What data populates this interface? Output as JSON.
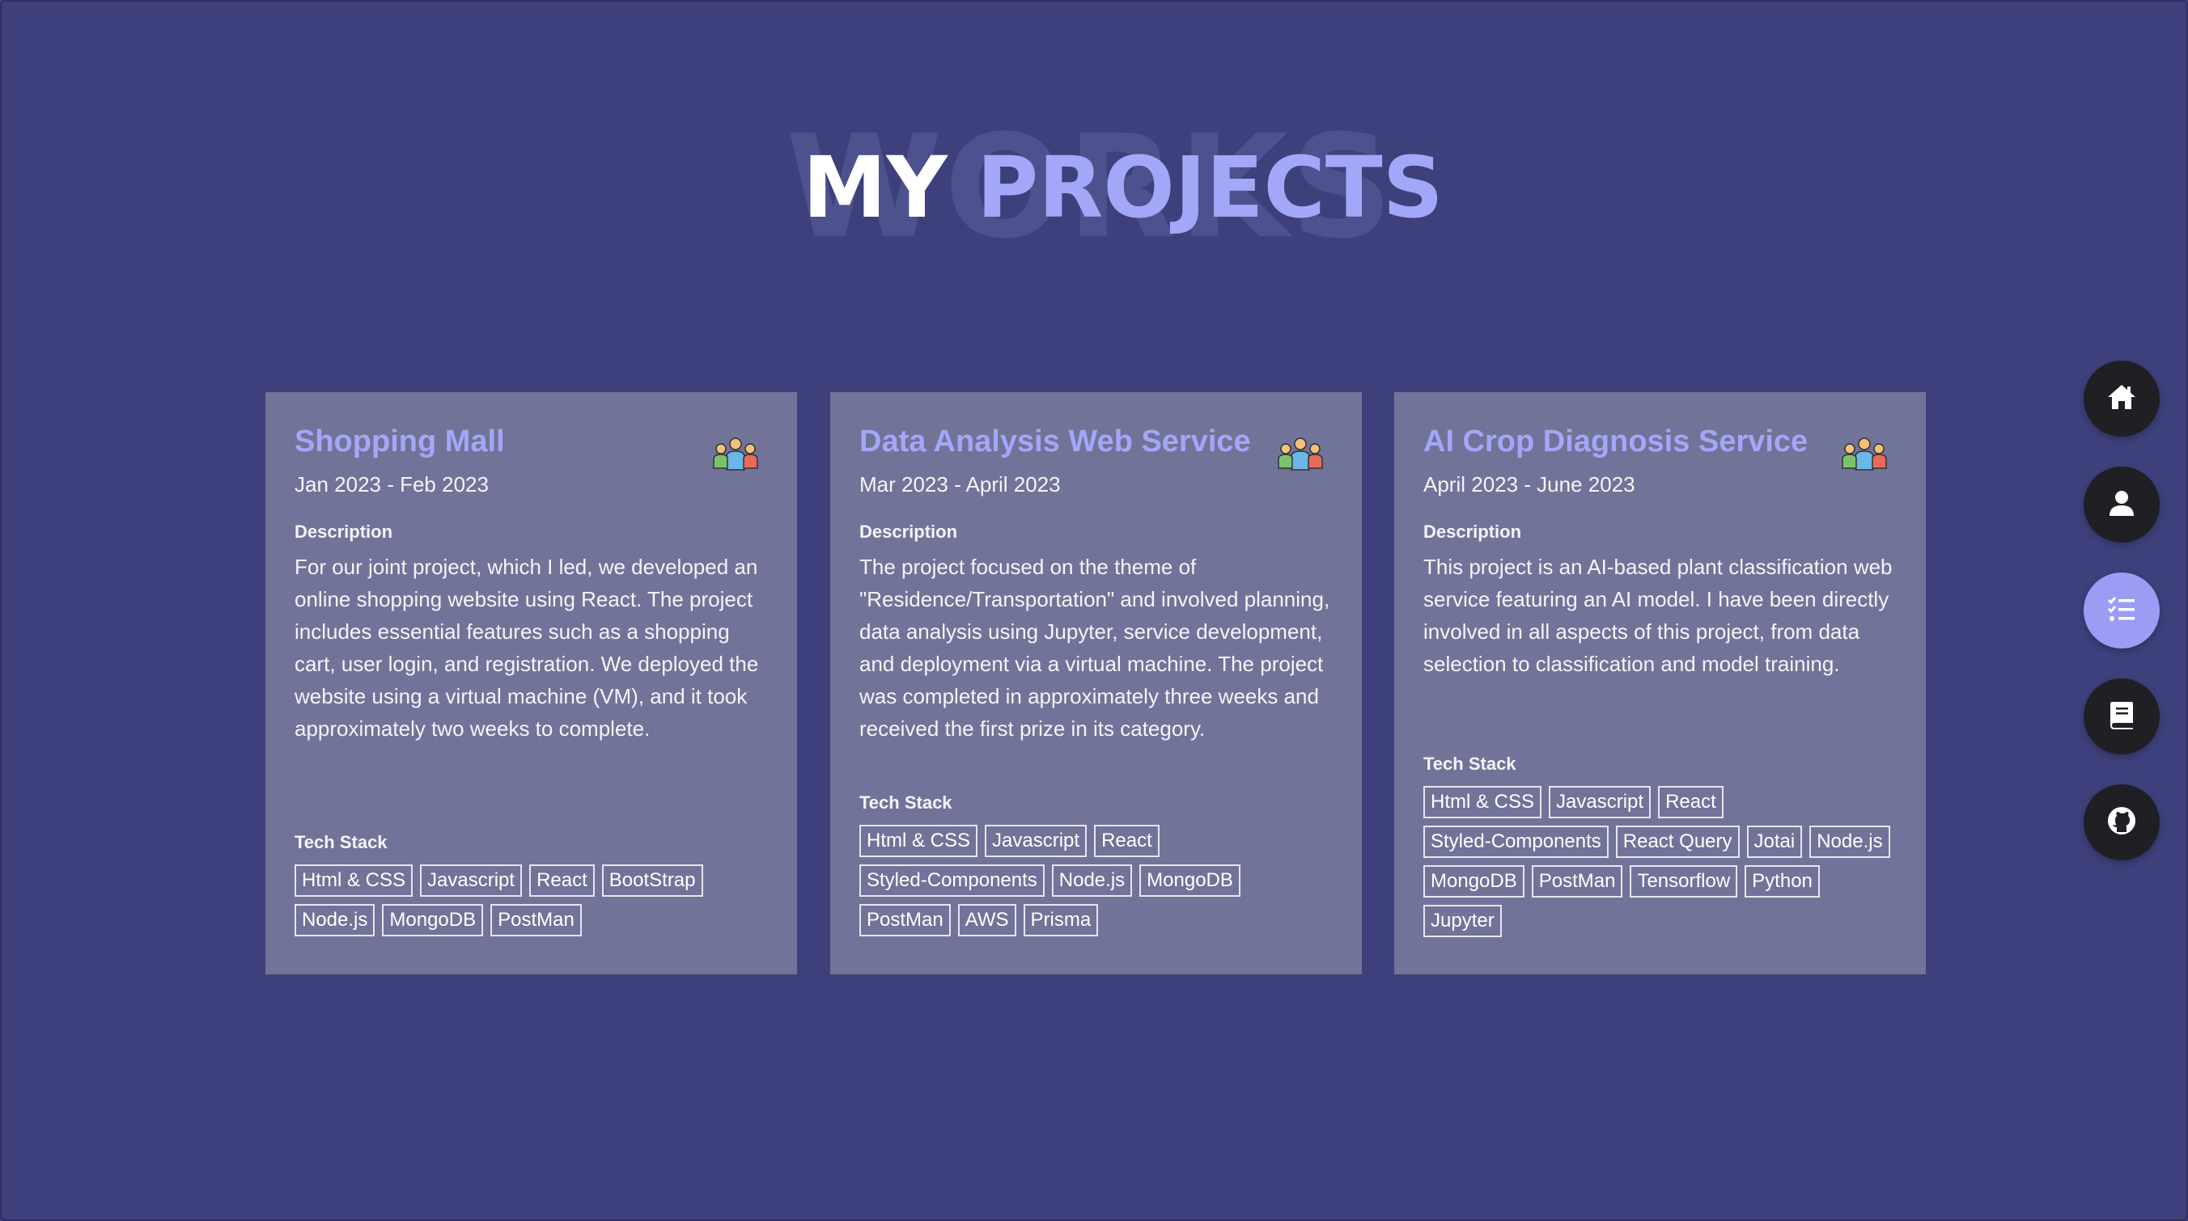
{
  "header": {
    "background_word": "WORKS",
    "title_part1": "MY",
    "title_part2": "PROJECTS"
  },
  "cards": [
    {
      "title": "Shopping Mall",
      "date": "Jan 2023 - Feb 2023",
      "icon": "team-icon",
      "description_label": "Description",
      "description": "For our joint project, which I led, we developed an online shopping website using React. The project includes essential features such as a shopping cart, user login, and registration. We deployed the website using a virtual machine (VM), and it took approximately two weeks to complete.",
      "tech_label": "Tech Stack",
      "tech": [
        "Html & CSS",
        "Javascript",
        "React",
        "BootStrap",
        "Node.js",
        "MongoDB",
        "PostMan"
      ]
    },
    {
      "title": "Data Analysis Web Service",
      "date": "Mar 2023 - April 2023",
      "icon": "team-icon",
      "description_label": "Description",
      "description": "The project focused on the theme of \"Residence/Transportation\" and involved planning, data analysis using Jupyter, service development, and deployment via a virtual machine. The project was completed in approximately three weeks and received the first prize in its category.",
      "tech_label": "Tech Stack",
      "tech": [
        "Html & CSS",
        "Javascript",
        "React",
        "Styled-Components",
        "Node.js",
        "MongoDB",
        "PostMan",
        "AWS",
        "Prisma"
      ]
    },
    {
      "title": "AI Crop Diagnosis Service",
      "date": "April 2023 - June 2023",
      "icon": "team-icon",
      "description_label": "Description",
      "description": "This project is an AI-based plant classification web service featuring an AI model. I have been directly involved in all aspects of this project, from data selection to classification and model training.",
      "tech_label": "Tech Stack",
      "tech": [
        "Html & CSS",
        "Javascript",
        "React",
        "Styled-Components",
        "React Query",
        "Jotai",
        "Node.js",
        "MongoDB",
        "PostMan",
        "Tensorflow",
        "Python",
        "Jupyter"
      ]
    }
  ],
  "nav": [
    {
      "icon": "home-icon",
      "active": false
    },
    {
      "icon": "user-icon",
      "active": false
    },
    {
      "icon": "list-icon",
      "active": true
    },
    {
      "icon": "book-icon",
      "active": false
    },
    {
      "icon": "github-icon",
      "active": false
    }
  ],
  "colors": {
    "background": "#3d407a",
    "card": "#727398",
    "accent": "#a3a7f7",
    "nav_button": "#1f1f24",
    "nav_active": "#9b9df5"
  }
}
